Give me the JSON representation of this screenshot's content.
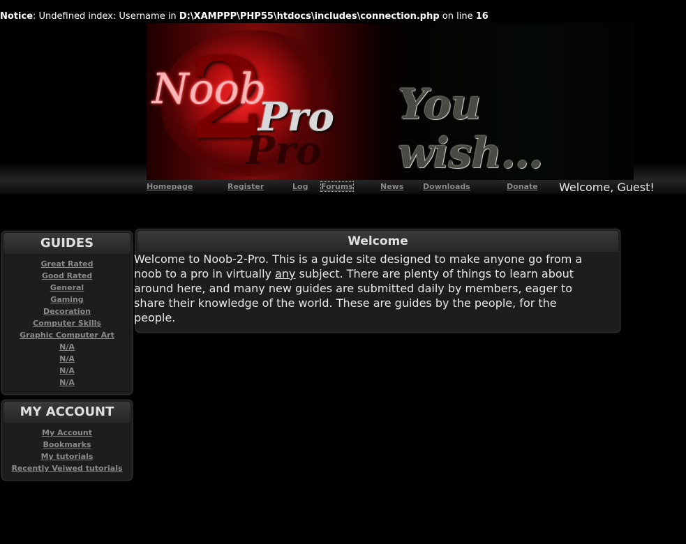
{
  "notice": {
    "label": "Notice",
    "message_a": ": Undefined index: Username in ",
    "path": "D:\\XAMPPP\\PHP55\\htdocs\\includes\\connection.php",
    "message_b": " on line ",
    "line": "16"
  },
  "banner": {
    "logo_noob": "Noob",
    "logo_two": "2",
    "logo_pro": "Pro",
    "tagline": "You wish..."
  },
  "nav": {
    "items": [
      {
        "label": "Homepage"
      },
      {
        "label": "Register"
      },
      {
        "label": "Log"
      },
      {
        "label": "Forums"
      },
      {
        "label": "News"
      },
      {
        "label": "Downloads"
      },
      {
        "label": "Donate"
      }
    ],
    "welcome": "Welcome, Guest!"
  },
  "guides": {
    "title": "GUIDES",
    "items": [
      "Great Rated",
      "Good Rated",
      "General",
      "Gaming",
      "Decoration",
      "Computer Skills",
      "Graphic Computer Art",
      "N/A",
      "N/A",
      "N/A",
      "N/A"
    ]
  },
  "account": {
    "title": "MY ACCOUNT",
    "items": [
      "My Account",
      "Bookmarks",
      "My tutorials",
      "Recently Veiwed tutorials"
    ]
  },
  "welcome_box": {
    "title": "Welcome",
    "text_a": "Welcome to Noob-2-Pro. This is a guide site designed to make anyone go from a noob to a pro in virtually ",
    "text_u": "any",
    "text_b": " subject. There are plenty of things to learn about around here, and many new guides are submitted daily by members, eager to share their knowledge of the world. These are guides by the people, for the people."
  }
}
